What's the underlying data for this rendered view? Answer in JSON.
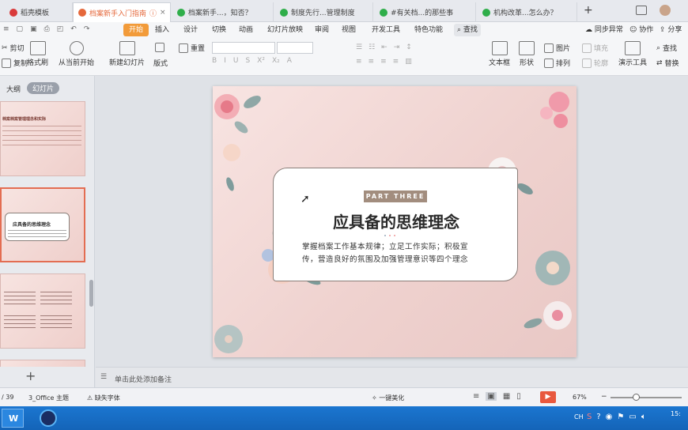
{
  "tabs": [
    {
      "label": "稻壳模板",
      "color": "#d93a3a"
    },
    {
      "label": "档案新手入门指南",
      "color": "#e5683b"
    },
    {
      "label": "档案新手...，知否？",
      "color": "#2fae4a"
    },
    {
      "label": "制度先行...管理制度",
      "color": "#2fae4a"
    },
    {
      "label": "#有关档...的那些事",
      "color": "#2fae4a"
    },
    {
      "label": "机构改革...怎么办？",
      "color": "#2fae4a"
    }
  ],
  "tab_new": "+",
  "menu": {
    "items": [
      "开始",
      "插入",
      "设计",
      "切换",
      "动画",
      "幻灯片放映",
      "审阅",
      "视图",
      "开发工具",
      "特色功能"
    ],
    "search": "查找",
    "right": [
      "同步异常",
      "协作",
      "分享"
    ]
  },
  "ribbon": {
    "cut": "剪切",
    "copy": "复制",
    "format_painter": "格式刷",
    "play_from_current": "从当前开始",
    "new_slide": "新建幻灯片",
    "layout": "版式",
    "reset": "重置",
    "textbox": "文本框",
    "shape": "形状",
    "picture": "图片",
    "arrange": "排列",
    "fill": "填充",
    "outline": "轮廓",
    "presenter": "演示工具",
    "find": "查找",
    "replace": "替换"
  },
  "left_pane": {
    "outline_tab": "大纲",
    "slides_tab": "幻灯片",
    "add_button": "+",
    "thumb1_title": "档案档案管理理念和实际",
    "thumb2_title": "应具备的思维理念"
  },
  "slide": {
    "badge": "PART THREE",
    "title": "应具备的思维理念",
    "body_line1": "掌握档案工作基本规律；立足工作实际；积极宣",
    "body_line2": "传，营造良好的氛围及加强管理意识等四个理念"
  },
  "notes_placeholder": "单击此处添加备注",
  "status": {
    "page": "/ 39",
    "theme": "3_Office 主题",
    "missing_font": "缺失字体",
    "beautify": "一键美化",
    "zoom": "67%"
  },
  "taskbar": {
    "tray_text": "CH",
    "clock": "15:"
  }
}
